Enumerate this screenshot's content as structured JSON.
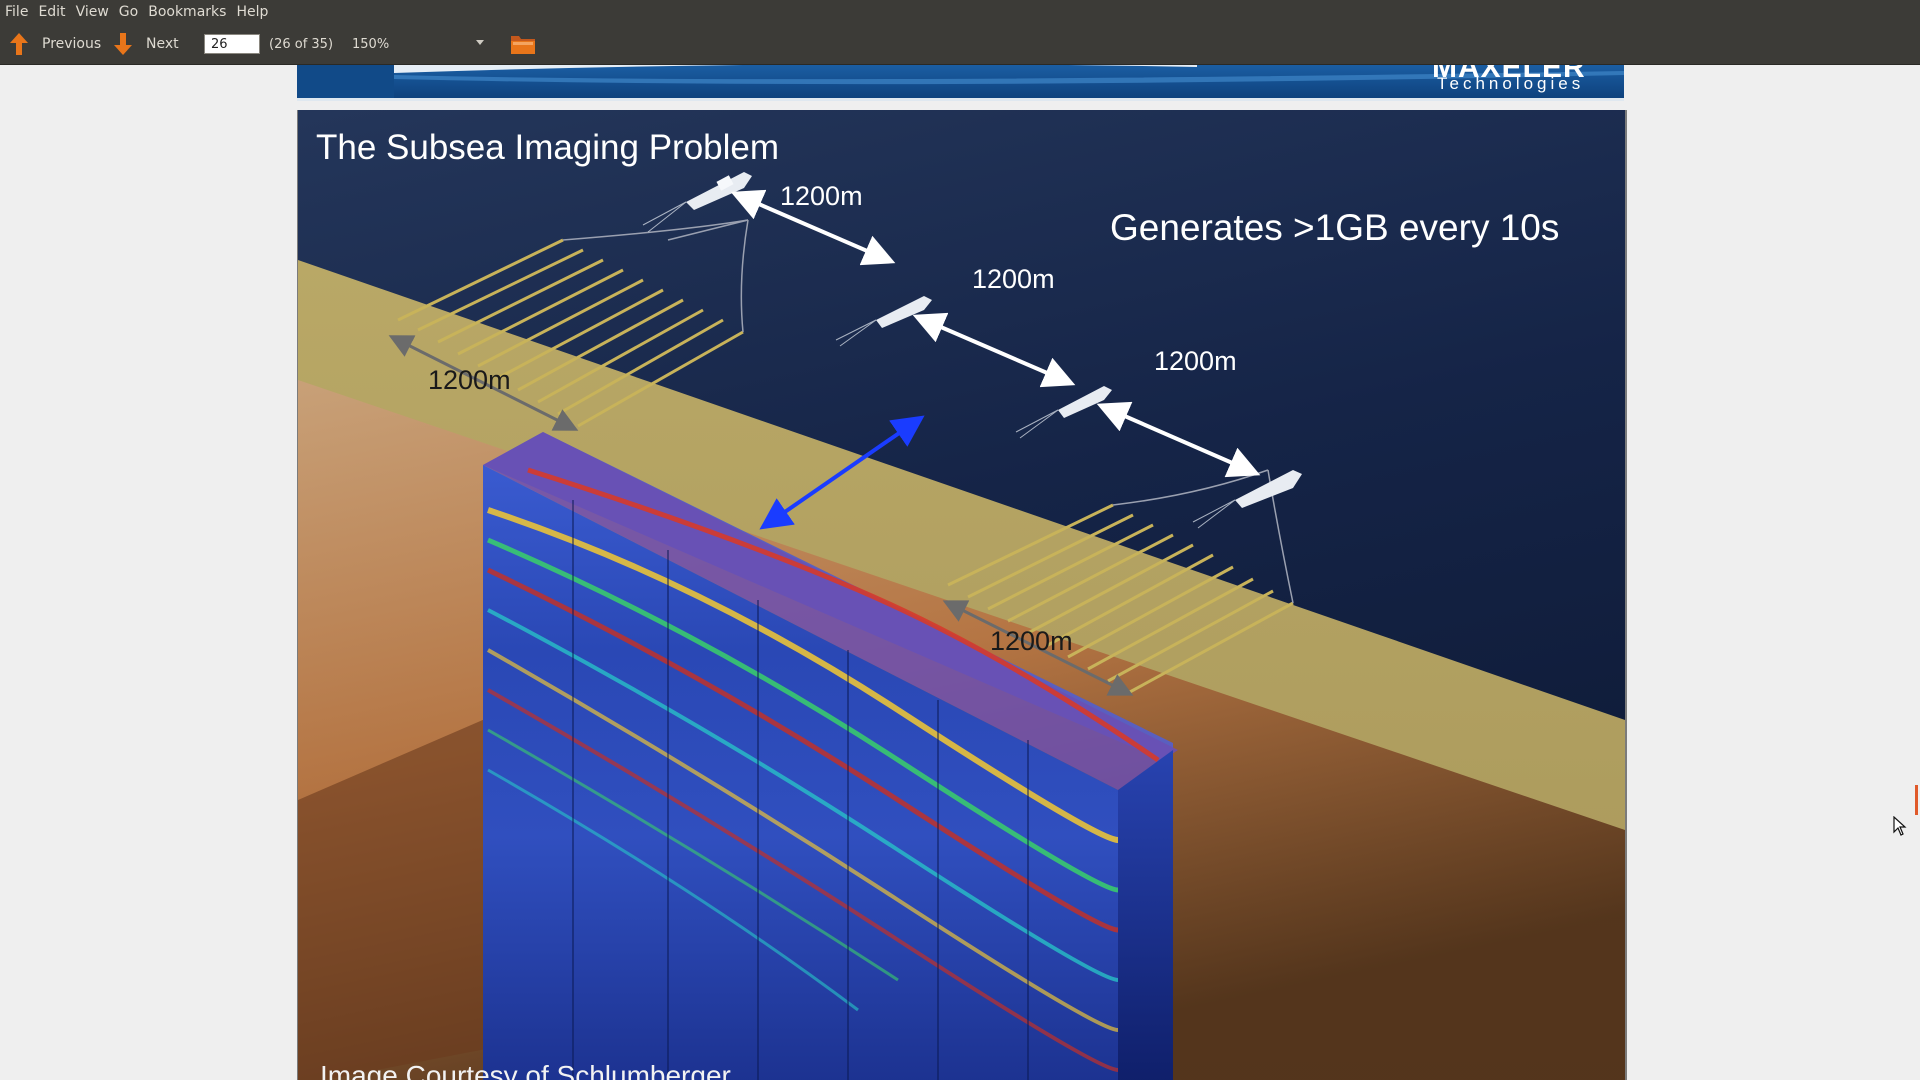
{
  "menu": [
    "File",
    "Edit",
    "View",
    "Go",
    "Bookmarks",
    "Help"
  ],
  "toolbar": {
    "previous_label": "Previous",
    "next_label": "Next",
    "page_value": "26",
    "page_count": "(26 of 35)",
    "zoom": "150%"
  },
  "header_logo": "MAXELER",
  "header_logo_sub": "Technologies",
  "slide": {
    "title": "The Subsea Imaging Problem",
    "headline": "Generates  >1GB every 10s",
    "distance_1": "1200m",
    "distance_2": "1200m",
    "distance_3": "1200m",
    "distance_4": "1200m",
    "distance_5": "1200m",
    "credit": "Image Courtesy of Schlumberger"
  },
  "colors": {
    "chrome": "#3c3b37",
    "accent_arrow": "#e8751a",
    "ocean": "#1b2a4a",
    "seafloor": "#c9b36a"
  }
}
